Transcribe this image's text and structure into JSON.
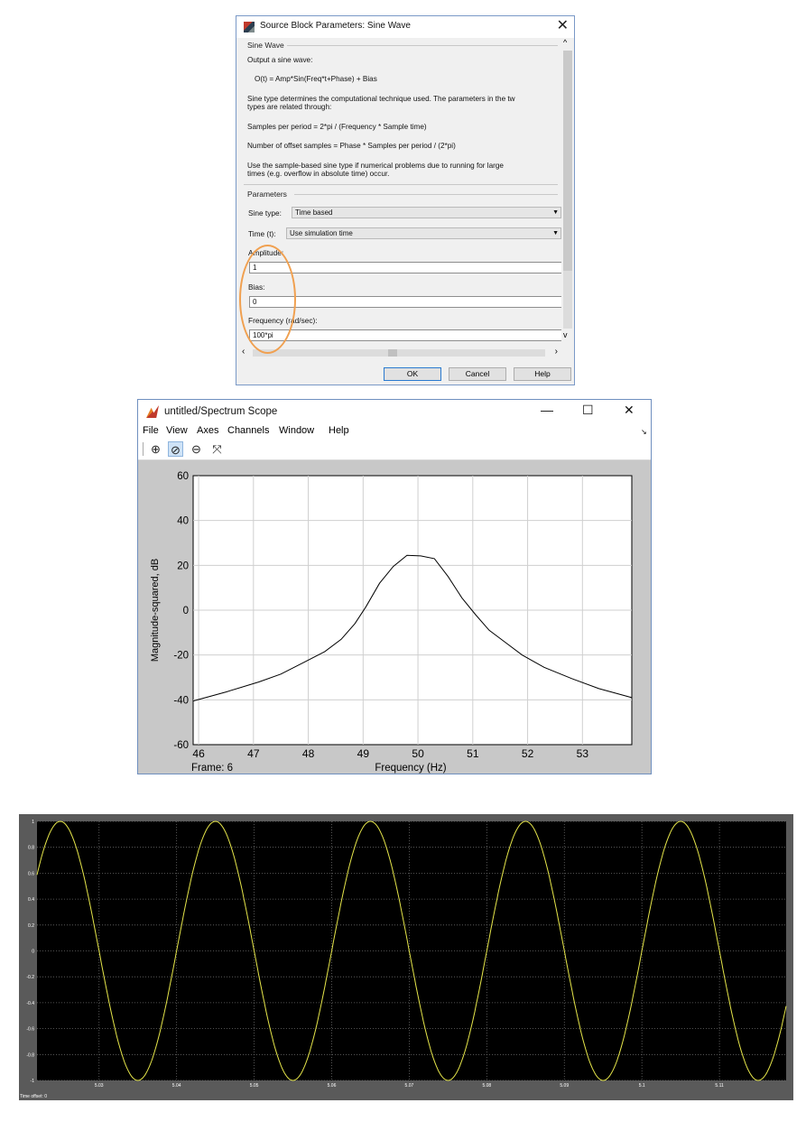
{
  "dialog": {
    "title": "Source Block Parameters: Sine Wave",
    "section_sine": "Sine Wave",
    "desc_line1": "Output a sine wave:",
    "desc_formula": "O(t) = Amp*Sin(Freq*t+Phase) + Bias",
    "desc_type_1": "Sine type determines the computational technique used. The parameters in the tw",
    "desc_type_2": "types are related through:",
    "desc_samples": "Samples per period = 2*pi / (Frequency * Sample time)",
    "desc_offset": "Number of offset samples = Phase * Samples per period / (2*pi)",
    "desc_use_1": "Use the sample-based sine type if numerical problems due to running for large",
    "desc_use_2": "times (e.g. overflow in absolute time) occur.",
    "section_params": "Parameters",
    "sine_type_label": "Sine type:",
    "sine_type_value": "Time based",
    "time_label": "Time (t):",
    "time_value": "Use simulation time",
    "amplitude_label": "Amplitude:",
    "amplitude_value": "1",
    "bias_label": "Bias:",
    "bias_value": "0",
    "frequency_label": "Frequency (rad/sec):",
    "frequency_value": "100*pi",
    "ok_label": "OK",
    "cancel_label": "Cancel",
    "help_label": "Help",
    "annotation_color": "#f0a050"
  },
  "spectrum": {
    "title": "untitled/Spectrum Scope",
    "menu": [
      "File",
      "View",
      "Axes",
      "Channels",
      "Window",
      "Help"
    ],
    "frame_label": "Frame: 6",
    "toolbar_icons": [
      "zoom-in-icon",
      "zoom-x-icon",
      "zoom-y-icon",
      "autoscale-icon"
    ]
  },
  "time_scope": {
    "offset_label": "Time offset:  0",
    "trace_color": "#e6e64a"
  },
  "chart_data": [
    {
      "type": "line",
      "title": "",
      "xlabel": "Frequency (Hz)",
      "ylabel": "Magnitude-squared, dB",
      "xlim": [
        45.9,
        53.9
      ],
      "ylim": [
        -60,
        60
      ],
      "xticks": [
        46,
        47,
        48,
        49,
        50,
        51,
        52,
        53
      ],
      "yticks": [
        60,
        40,
        20,
        0,
        -20,
        -40,
        -60
      ],
      "grid": true,
      "x": [
        45.9,
        46.5,
        47.1,
        47.5,
        47.9,
        48.3,
        48.6,
        48.85,
        49.05,
        49.3,
        49.55,
        49.8,
        50.05,
        50.3,
        50.55,
        50.8,
        51.05,
        51.3,
        51.6,
        51.9,
        52.3,
        52.8,
        53.3,
        53.9
      ],
      "y": [
        -40.5,
        -36.5,
        -32,
        -28.5,
        -23.5,
        -18.5,
        -13,
        -6,
        1.5,
        12,
        19.5,
        24.5,
        24.2,
        23,
        15,
        5.5,
        -2,
        -9,
        -14.5,
        -20,
        -25.5,
        -30.5,
        -35,
        -39
      ]
    },
    {
      "type": "line",
      "title": "",
      "xlabel": "",
      "ylabel": "",
      "xlim": [
        5.022,
        5.1186
      ],
      "ylim": [
        -1,
        1
      ],
      "xticks": [
        5.03,
        5.04,
        5.05,
        5.06,
        5.07,
        5.08,
        5.09,
        5.1,
        5.11
      ],
      "xtick_labels": [
        "5.03",
        "5.04",
        "5.05",
        "5.06",
        "5.07",
        "5.08",
        "5.09",
        "5.1",
        "5.11"
      ],
      "yticks": [
        1,
        0.8,
        0.6,
        0.4,
        0.2,
        0,
        -0.2,
        -0.4,
        -0.6,
        -0.8,
        -1
      ],
      "ytick_labels": [
        "1",
        "0.8",
        "0.6",
        "0.4",
        "0.2",
        "0",
        "-0.2",
        "-0.4",
        "-0.6",
        "-0.8",
        "-1"
      ],
      "grid": true,
      "series": [
        {
          "amplitude": 1,
          "frequency_hz": 50,
          "bias": 0
        }
      ]
    }
  ]
}
